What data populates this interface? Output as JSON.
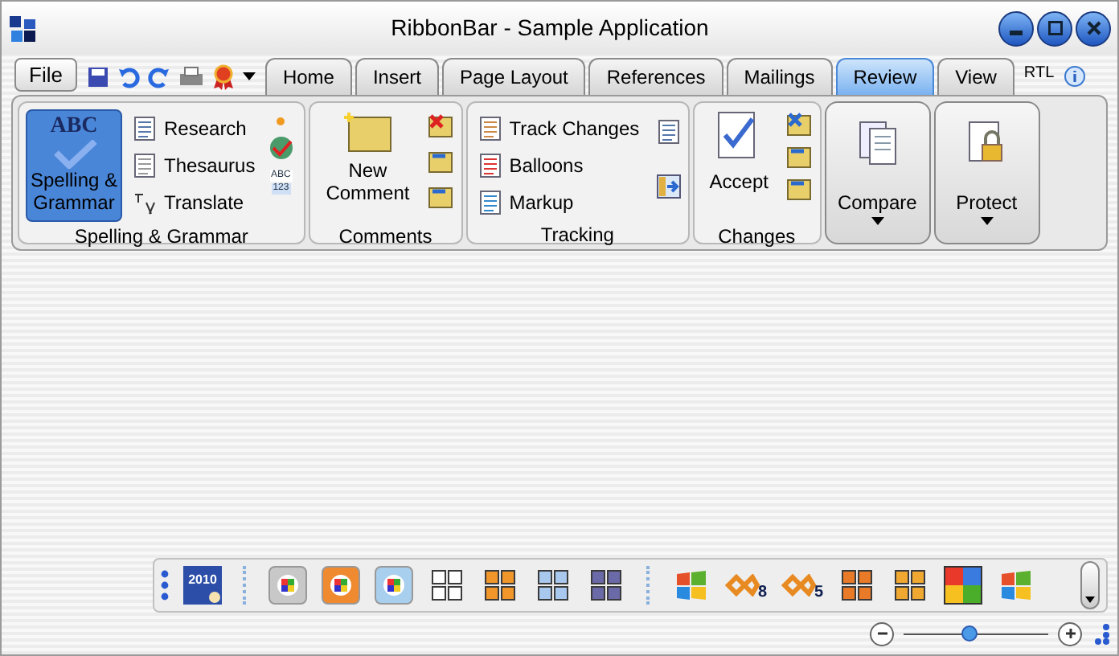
{
  "window": {
    "title": "RibbonBar - Sample Application"
  },
  "file_button": "File",
  "tabs": [
    {
      "label": "Home",
      "selected": false
    },
    {
      "label": "Insert",
      "selected": false
    },
    {
      "label": "Page Layout",
      "selected": false
    },
    {
      "label": "References",
      "selected": false
    },
    {
      "label": "Mailings",
      "selected": false
    },
    {
      "label": "Review",
      "selected": true
    },
    {
      "label": "View",
      "selected": false
    }
  ],
  "rtl": "RTL",
  "spelling_group": {
    "label": "Spelling & Grammar",
    "large": {
      "label": "Spelling & Grammar",
      "icon_text": "ABC",
      "selected": true
    },
    "items": [
      "Research",
      "Thesaurus",
      "Translate"
    ],
    "small_icon_text": [
      "ABC",
      "123"
    ]
  },
  "comments_group": {
    "label": "Comments",
    "large": {
      "label": "New Comment"
    }
  },
  "tracking_group": {
    "label": "Tracking",
    "items": [
      "Track Changes",
      "Balloons",
      "Markup"
    ]
  },
  "changes_group": {
    "label": "Changes",
    "large": {
      "label": "Accept"
    }
  },
  "big_buttons": [
    {
      "label": "Compare",
      "kind": "compare"
    },
    {
      "label": "Protect",
      "kind": "protect"
    }
  ],
  "themes": [
    {
      "kind": "calendar",
      "label": "2010"
    },
    {
      "kind": "separator"
    },
    {
      "kind": "office",
      "color": "#c8c8c8"
    },
    {
      "kind": "office",
      "color": "#f08a30"
    },
    {
      "kind": "office",
      "color": "#a8cfee"
    },
    {
      "kind": "squares",
      "color": "#ffffff"
    },
    {
      "kind": "squares",
      "color": "#f0962a"
    },
    {
      "kind": "squares",
      "color": "#a9c8ee"
    },
    {
      "kind": "squares",
      "color": "#6b6aa8"
    },
    {
      "kind": "separator"
    },
    {
      "kind": "flag"
    },
    {
      "kind": "vs",
      "label": "8"
    },
    {
      "kind": "vs",
      "label": "5"
    },
    {
      "kind": "squares",
      "color": "#e87a28"
    },
    {
      "kind": "squares",
      "color": "#f0a830"
    },
    {
      "kind": "puzzle"
    },
    {
      "kind": "flag"
    }
  ],
  "zoom": {
    "level": 0.46
  }
}
